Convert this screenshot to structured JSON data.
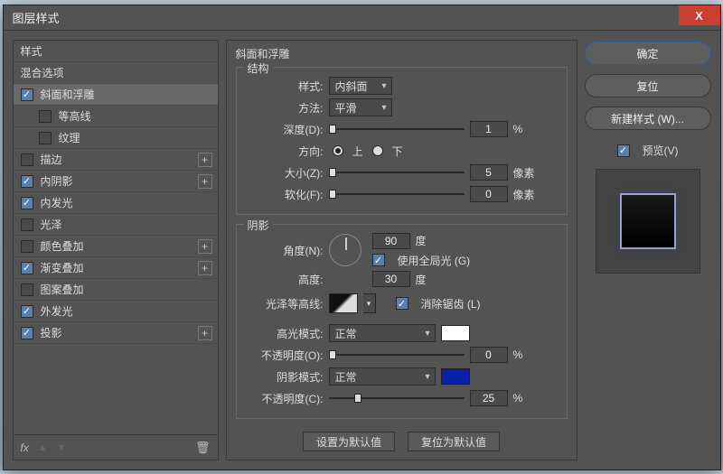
{
  "title": "图层样式",
  "close": "X",
  "left": {
    "styles_header": "样式",
    "blend_header": "混合选项",
    "items": [
      {
        "label": "斜面和浮雕",
        "checked": true,
        "selected": true,
        "sub": false,
        "plus": false
      },
      {
        "label": "等高线",
        "checked": false,
        "selected": false,
        "sub": true,
        "plus": false
      },
      {
        "label": "纹理",
        "checked": false,
        "selected": false,
        "sub": true,
        "plus": false
      },
      {
        "label": "描边",
        "checked": false,
        "selected": false,
        "sub": false,
        "plus": true
      },
      {
        "label": "内阴影",
        "checked": true,
        "selected": false,
        "sub": false,
        "plus": true
      },
      {
        "label": "内发光",
        "checked": true,
        "selected": false,
        "sub": false,
        "plus": false
      },
      {
        "label": "光泽",
        "checked": false,
        "selected": false,
        "sub": false,
        "plus": false
      },
      {
        "label": "颜色叠加",
        "checked": false,
        "selected": false,
        "sub": false,
        "plus": true
      },
      {
        "label": "渐变叠加",
        "checked": true,
        "selected": false,
        "sub": false,
        "plus": true
      },
      {
        "label": "图案叠加",
        "checked": false,
        "selected": false,
        "sub": false,
        "plus": false
      },
      {
        "label": "外发光",
        "checked": true,
        "selected": false,
        "sub": false,
        "plus": false
      },
      {
        "label": "投影",
        "checked": true,
        "selected": false,
        "sub": false,
        "plus": true
      }
    ],
    "fx": "fx"
  },
  "center": {
    "title": "斜面和浮雕",
    "structure": {
      "legend": "结构",
      "style_label": "样式:",
      "style_value": "内斜面",
      "technique_label": "方法:",
      "technique_value": "平滑",
      "depth_label": "深度(D):",
      "depth_value": "1",
      "depth_unit": "%",
      "direction_label": "方向:",
      "dir_up": "上",
      "dir_down": "下",
      "size_label": "大小(Z):",
      "size_value": "5",
      "size_unit": "像素",
      "soften_label": "软化(F):",
      "soften_value": "0",
      "soften_unit": "像素"
    },
    "shading": {
      "legend": "阴影",
      "angle_label": "角度(N):",
      "angle_value": "90",
      "angle_unit": "度",
      "global_label": "使用全局光 (G)",
      "altitude_label": "高度:",
      "altitude_value": "30",
      "altitude_unit": "度",
      "contour_label": "光泽等高线:",
      "antialias_label": "消除锯齿 (L)",
      "highlight_mode_label": "高光模式:",
      "highlight_mode_value": "正常",
      "highlight_opacity_label": "不透明度(O):",
      "highlight_opacity_value": "0",
      "highlight_opacity_unit": "%",
      "shadow_mode_label": "阴影模式:",
      "shadow_mode_value": "正常",
      "shadow_opacity_label": "不透明度(C):",
      "shadow_opacity_value": "25",
      "shadow_opacity_unit": "%"
    },
    "make_default": "设置为默认值",
    "reset_default": "复位为默认值"
  },
  "right": {
    "ok": "确定",
    "cancel": "复位",
    "new_style": "新建样式 (W)...",
    "preview_label": "预览(V)"
  }
}
